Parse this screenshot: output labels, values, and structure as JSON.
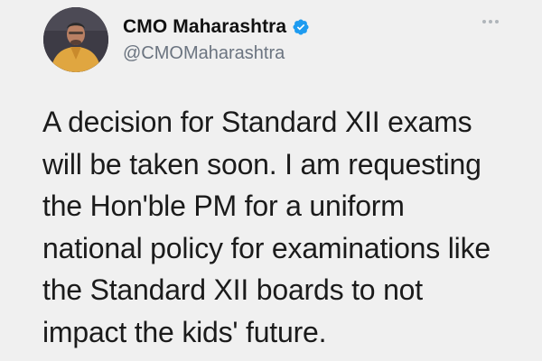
{
  "tweet": {
    "author": {
      "display_name": "CMO Maharashtra",
      "handle": "@CMOMaharashtra",
      "verified": true,
      "avatar_icon": "avatar-photo"
    },
    "more_icon": "more-horizontal-icon",
    "text_lines": [
      "A decision for Standard XII exams",
      "will be taken soon. I am requesting",
      "the Hon'ble PM for a uniform",
      "national policy for examinations like",
      "the Standard XII boards to not",
      "impact the kids' future."
    ]
  },
  "colors": {
    "background": "#f0f0f0",
    "verified_badge": "#1d9bf0",
    "handle_text": "#6b7480"
  }
}
